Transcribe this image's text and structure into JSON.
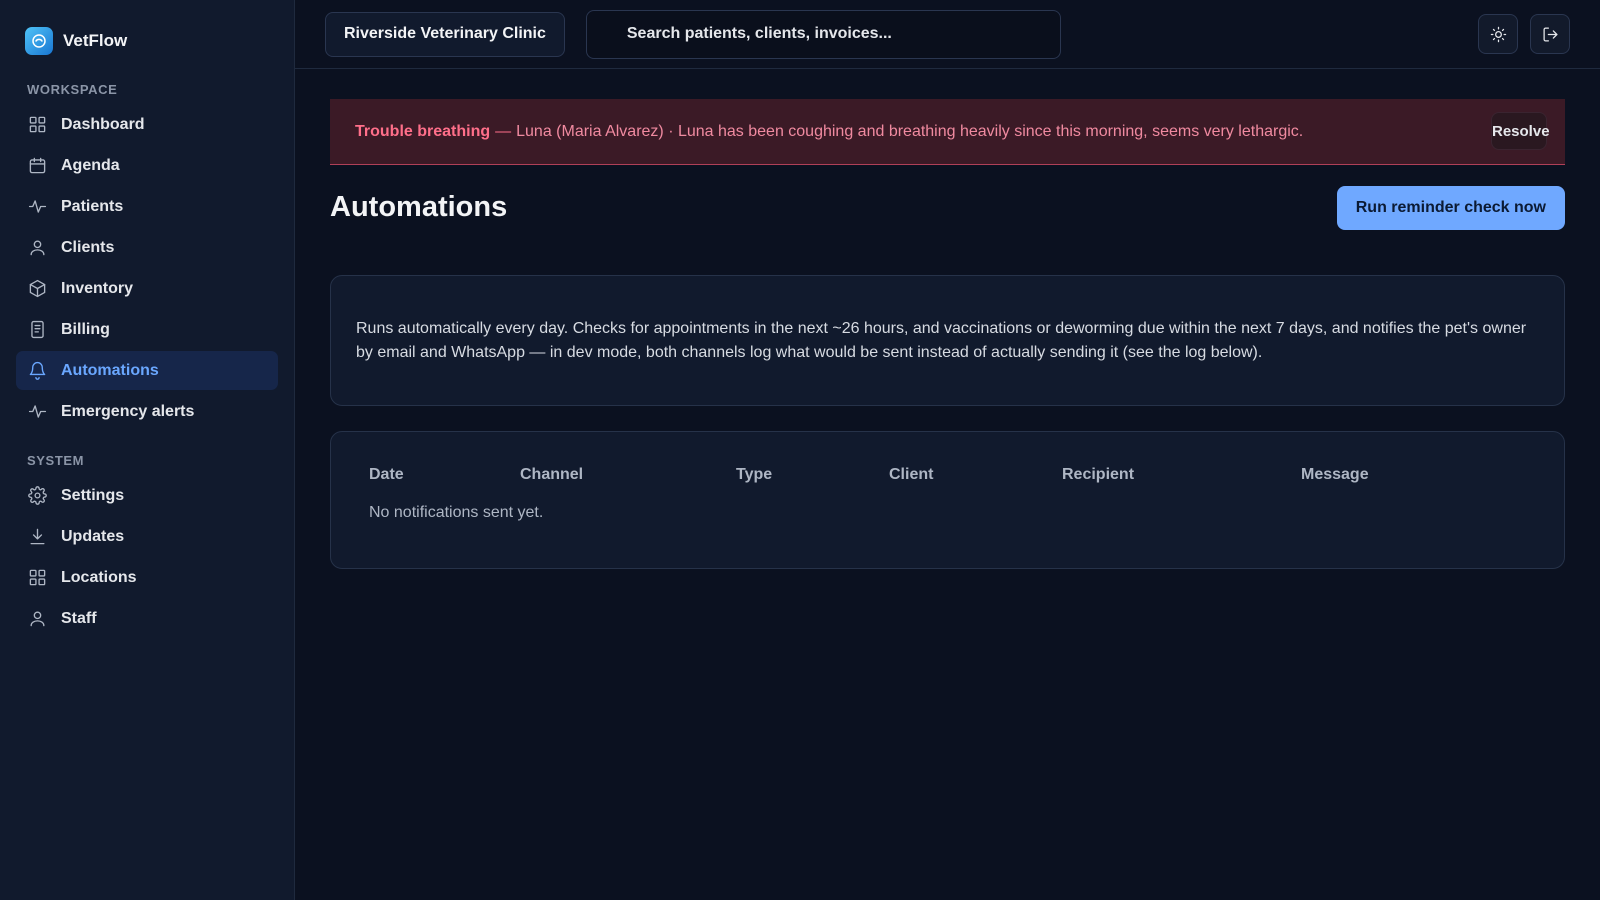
{
  "brand": {
    "name": "VetFlow"
  },
  "sidebar": {
    "workspace_label": "WORKSPACE",
    "system_label": "SYSTEM",
    "workspace_items": [
      {
        "label": "Dashboard",
        "icon": "grid-icon"
      },
      {
        "label": "Agenda",
        "icon": "calendar-icon"
      },
      {
        "label": "Patients",
        "icon": "activity-icon"
      },
      {
        "label": "Clients",
        "icon": "user-icon"
      },
      {
        "label": "Inventory",
        "icon": "box-icon"
      },
      {
        "label": "Billing",
        "icon": "receipt-icon"
      },
      {
        "label": "Automations",
        "icon": "bell-icon",
        "active": true
      },
      {
        "label": "Emergency alerts",
        "icon": "activity-icon"
      }
    ],
    "system_items": [
      {
        "label": "Settings",
        "icon": "gear-icon"
      },
      {
        "label": "Updates",
        "icon": "download-icon"
      },
      {
        "label": "Locations",
        "icon": "grid-icon"
      },
      {
        "label": "Staff",
        "icon": "user-icon"
      }
    ]
  },
  "topbar": {
    "clinic": "Riverside Veterinary Clinic",
    "search_placeholder": "Search patients, clients, invoices..."
  },
  "alert": {
    "title": "Trouble breathing",
    "separator": "—",
    "text": "Luna (Maria Alvarez) · Luna has been coughing and breathing heavily since this morning, seems very lethargic.",
    "resolve_label": "Resolve"
  },
  "page": {
    "title": "Automations",
    "run_button": "Run reminder check now",
    "description": "Runs automatically every day. Checks for appointments in the next ~26 hours, and vaccinations or deworming due within the next 7 days, and notifies the pet's owner by email and WhatsApp — in dev mode, both channels log what would be sent instead of actually sending it (see the log below)."
  },
  "table": {
    "columns": [
      "Date",
      "Channel",
      "Type",
      "Client",
      "Recipient",
      "Message"
    ],
    "empty": "No notifications sent yet."
  },
  "colors": {
    "background": "#0b1120",
    "sidebar": "#111a2d",
    "accent": "#6fa8ff",
    "alert_bg": "#3b1a26",
    "alert_text": "#ff6f8a"
  }
}
